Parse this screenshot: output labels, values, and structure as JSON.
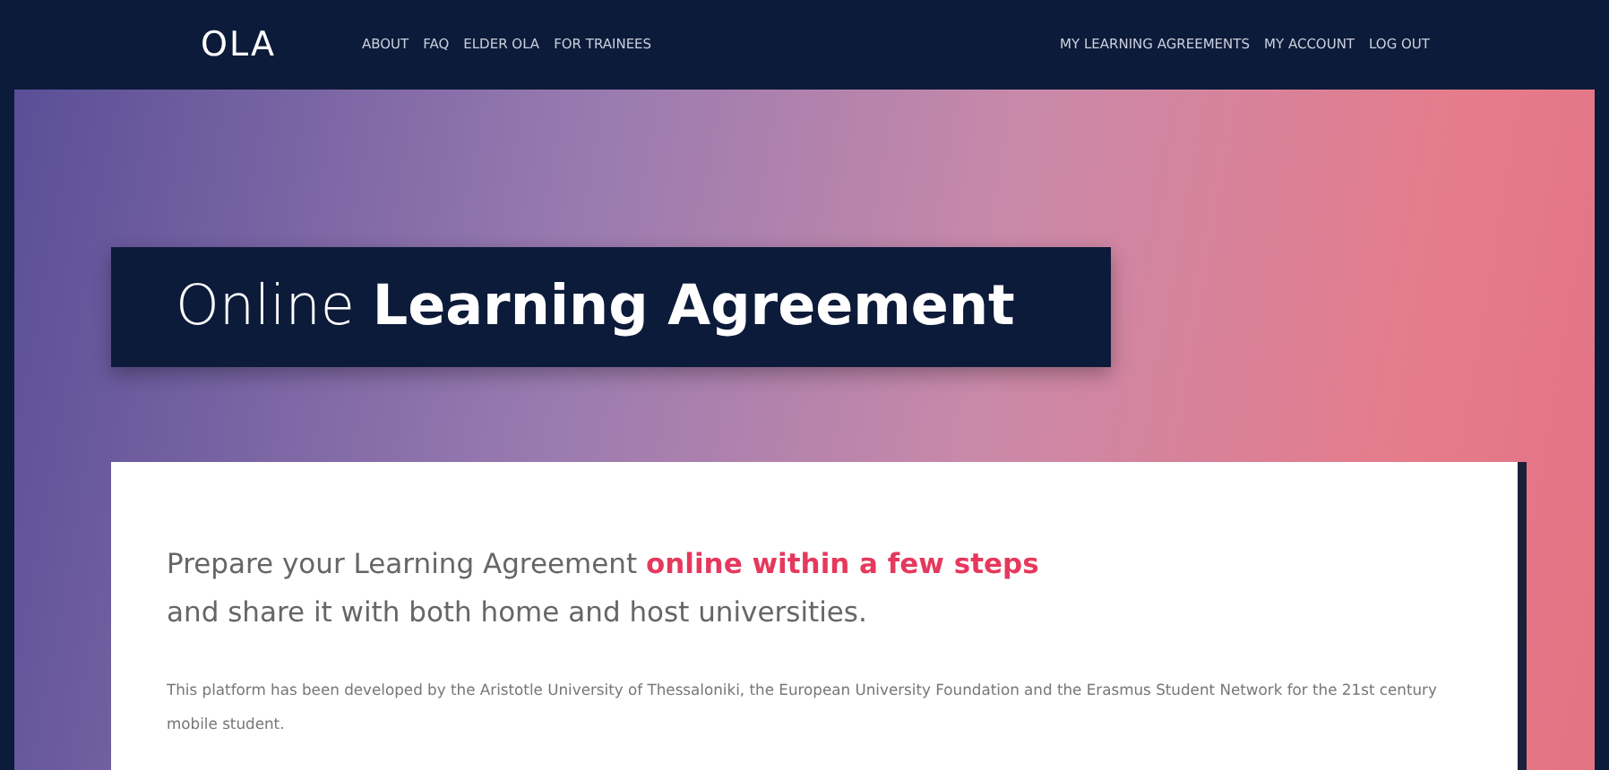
{
  "navbar": {
    "logo": "OLA",
    "left_links": [
      "ABOUT",
      "FAQ",
      "ELDER OLA",
      "FOR TRAINEES"
    ],
    "right_links": [
      "MY LEARNING AGREEMENTS",
      "MY ACCOUNT",
      "LOG OUT"
    ]
  },
  "hero": {
    "title": "Online **Learning Agreement**"
  },
  "intro": {
    "lines": [
      "Prepare your Learning Agreement **online within a few steps**",
      "and share it with both home and host universities."
    ],
    "description": "This platform has been developed by the Aristotle University of Thessaloniki, the European University Foundation and the Erasmus Student Network for the 21st century mobile student."
  }
}
